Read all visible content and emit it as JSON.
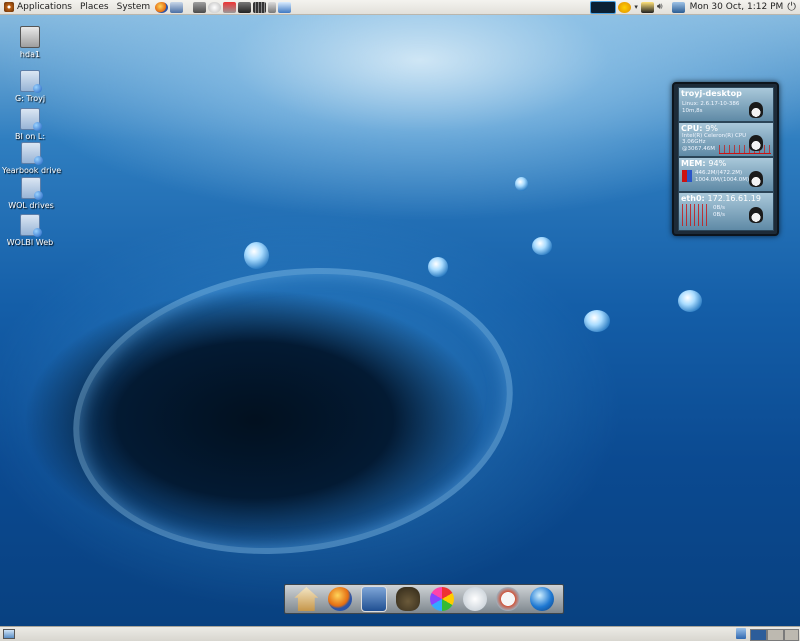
{
  "top_panel": {
    "menus": [
      {
        "label": "Applications",
        "icon": "gnome-foot-icon"
      },
      {
        "label": "Places",
        "icon": ""
      },
      {
        "label": "System",
        "icon": ""
      }
    ],
    "launchers": [
      "firefox-icon",
      "evolution-icon",
      "gimp-icon",
      "gaim-icon",
      "disks-icon",
      "terminal-icon",
      "calculator-icon",
      "phone-icon",
      "network-icon"
    ],
    "tray": [
      "cpu-graph-icon",
      "weather-icon",
      "network-status-icon",
      "volume-icon",
      "update-icon"
    ],
    "clock": "Mon 30 Oct,  1:12 PM",
    "shutdown_icon": "power-icon"
  },
  "desktop_icons": [
    {
      "label": "hda1",
      "icon": "drive-icon"
    },
    {
      "label": "G: Troyj",
      "icon": "network-folder-icon"
    },
    {
      "label": "BI on L:",
      "icon": "network-folder-icon"
    },
    {
      "label": "Yearbook drive",
      "icon": "network-folder-icon"
    },
    {
      "label": "WOL drives",
      "icon": "network-folder-icon"
    },
    {
      "label": "WOLBI Web",
      "icon": "network-folder-icon"
    }
  ],
  "conky": {
    "host": {
      "title": "troyj-desktop",
      "line1": "Linux: 2.6.17-10-386",
      "line2": "10m,8s"
    },
    "cpu": {
      "title": "CPU:",
      "value": "9%",
      "line1": "Intel(R) Celeron(R) CPU",
      "line2": "3.06GHz",
      "line3": "@3067.46M"
    },
    "mem": {
      "title": "MEM:",
      "value": "94%",
      "line1": "446.2M/(472.2M)",
      "line2": "1004.0M/(1004.0M)"
    },
    "net": {
      "title": "eth0:",
      "value": "172.16.61.19",
      "line1": "0B/s",
      "line2": "0B/s"
    }
  },
  "dock": [
    "home-icon",
    "firefox-icon",
    "mail-icon",
    "gimp-icon",
    "picasa-icon",
    "writer-icon",
    "impress-icon",
    "google-earth-icon"
  ],
  "bottom_panel": {
    "show_desktop_icon": "show-desktop-icon",
    "trash_icon": "trash-icon"
  },
  "colors": {
    "panel": "#e6e4de",
    "desktop": "#145ea8",
    "conky_bg": "#1d2b38"
  }
}
